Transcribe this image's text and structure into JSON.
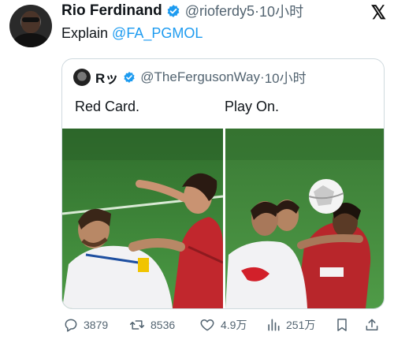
{
  "tweet": {
    "author_name": "Rio Ferdinand",
    "author_handle": "@rioferdy5",
    "time": "10小时",
    "text_prefix": "Explain ",
    "mention": "@FA_PGMOL",
    "platform_logo": "𝕏"
  },
  "quote": {
    "author_name": "Rッ",
    "author_handle": "@TheFergusonWay",
    "time": "10小时",
    "caption_left": "Red Card.",
    "caption_right": "Play On."
  },
  "actions": {
    "replies": "3879",
    "retweets": "8536",
    "likes": "4.9万",
    "views": "251万"
  },
  "icons": {
    "verified": "verified-badge-icon",
    "reply": "reply-icon",
    "retweet": "retweet-icon",
    "like": "heart-icon",
    "views": "views-icon",
    "bookmark": "bookmark-icon",
    "share": "share-icon"
  },
  "colors": {
    "accent": "#1d9bf0",
    "secondary_text": "#536471",
    "pitch": "#3f8a3a"
  }
}
